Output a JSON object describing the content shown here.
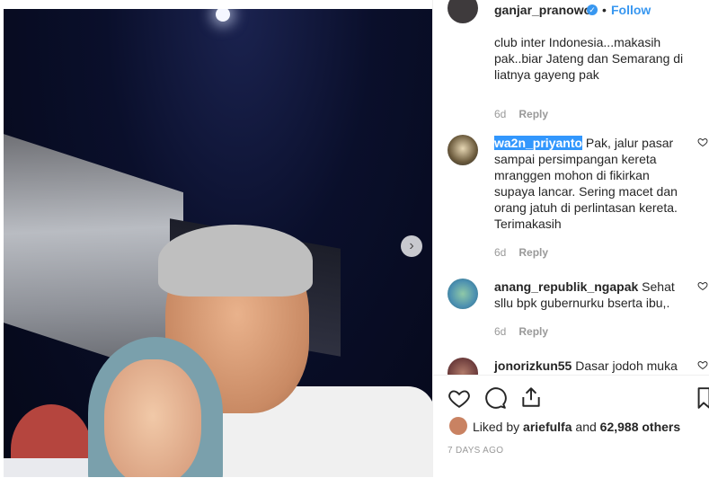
{
  "post": {
    "author": "ganjar_pranowo",
    "verified_badge": "✓",
    "separator": "•",
    "follow_label": "Follow"
  },
  "comments": [
    {
      "username": "",
      "text": "club inter Indonesia...makasih pak..biar Jateng dan Semarang di liatnya gayeng pak",
      "age": "6d",
      "reply_label": "Reply"
    },
    {
      "username": "wa2n_priyanto",
      "text": " Pak, jalur pasar sampai persimpangan kereta mranggen mohon di fikirkan supaya lancar. Sering macet dan orang jatuh di perlintasan kereta. Terimakasih",
      "age": "6d",
      "reply_label": "Reply"
    },
    {
      "username": "anang_republik_ngapak",
      "text": " Sehat sllu bpk gubernurku bserta ibu,.",
      "age": "6d",
      "reply_label": "Reply"
    },
    {
      "username": "jonorizkun55",
      "text": " Dasar jodoh muka",
      "age": "",
      "reply_label": ""
    }
  ],
  "likes": {
    "prefix": "Liked by ",
    "user": "ariefulfa",
    "middle": " and ",
    "count": "62,988 others"
  },
  "timestamp": "7 DAYS AGO",
  "icons": {
    "like": "heart-icon",
    "comment": "comment-icon",
    "share": "share-icon",
    "save": "bookmark-icon",
    "next": "chevron-right-icon"
  },
  "colors": {
    "link_blue": "#3897f0",
    "selection_blue": "#3297fd",
    "muted": "#999999"
  }
}
